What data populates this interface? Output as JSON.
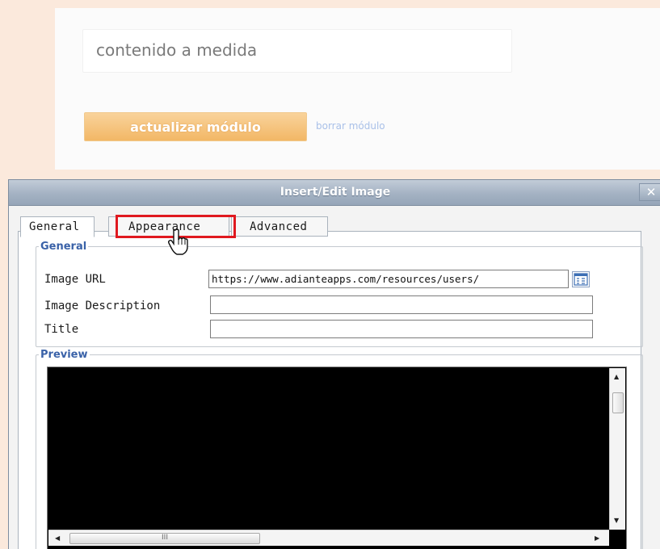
{
  "background": {
    "content_input_value": "contenido a medida",
    "update_button_label": "actualizar módulo",
    "delete_link_label": "borrar módulo"
  },
  "dialog": {
    "title": "Insert/Edit Image",
    "close_label": "✕",
    "tabs": [
      {
        "label": "General",
        "active": true
      },
      {
        "label": "Appearance",
        "active": false,
        "highlighted": true
      },
      {
        "label": "Advanced",
        "active": false
      }
    ],
    "general_section": {
      "legend": "General",
      "fields": [
        {
          "label": "Image URL",
          "value": "https://www.adianteapps.com/resources/users/"
        },
        {
          "label": "Image Description",
          "value": ""
        },
        {
          "label": "Title",
          "value": ""
        }
      ]
    },
    "preview_section": {
      "legend": "Preview",
      "hscroll_thumb_glyph": "III"
    }
  },
  "colors": {
    "highlight": "#e0191f",
    "accent_button": "#f2b766",
    "legend_text": "#3a62a8",
    "titlebar": "#a4b2c3"
  },
  "icons": [
    "close-icon",
    "browse-icon",
    "hand-cursor-icon",
    "scroll-arrow-icon"
  ]
}
